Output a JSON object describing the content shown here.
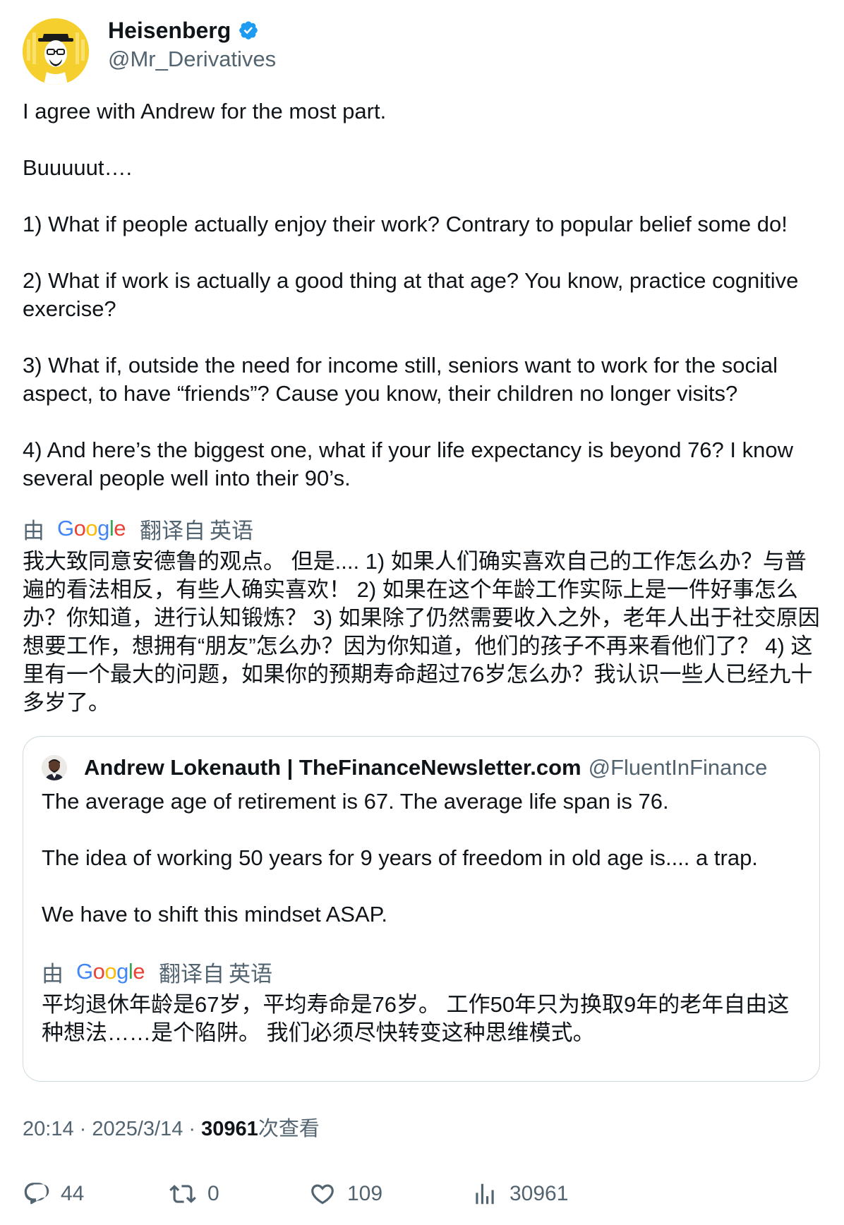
{
  "author": {
    "display_name": "Heisenberg",
    "handle": "@Mr_Derivatives",
    "verified": true,
    "avatar_icon": "heisenberg-avatar"
  },
  "tweet": {
    "text": "I agree with Andrew for the most part.\n\nBuuuuut….\n\n1) What if people actually enjoy their work? Contrary to popular belief some do!\n\n2) What if work is actually a good thing at that age? You know, practice cognitive exercise?\n\n3) What if, outside the need for income still, seniors want to work for the social aspect, to have “friends”? Cause you know, their children no longer visits?\n\n4) And here’s the biggest one, what if your life expectancy is beyond 76? I know several people well into their 90’s.",
    "translated_by_prefix": "由",
    "translated_by_suffix": "翻译自",
    "source_language": "英语",
    "translation": "我大致同意安德鲁的观点。 但是.... 1) 如果人们确实喜欢自己的工作怎么办？与普遍的看法相反，有些人确实喜欢！ 2) 如果在这个年龄工作实际上是一件好事怎么办？你知道，进行认知锻炼？ 3) 如果除了仍然需要收入之外，老年人出于社交原因想要工作，想拥有“朋友”怎么办？因为你知道，他们的孩子不再来看他们了？ 4) 这里有一个最大的问题，如果你的预期寿命超过76岁怎么办？我认识一些人已经九十多岁了。"
  },
  "quoted_tweet": {
    "display_name": "Andrew Lokenauth | TheFinanceNewsletter.com",
    "handle": "@FluentInFinance",
    "text": "The average age of retirement is 67. The average life span is 76.\n\nThe idea of working 50 years for 9 years of freedom in old age is.... a trap.\n\nWe have to shift this mindset ASAP.",
    "translated_by_prefix": "由",
    "translated_by_suffix": "翻译自",
    "source_language": "英语",
    "translation": "平均退休年龄是67岁，平均寿命是76岁。 工作50年只为换取9年的老年自由这种想法……是个陷阱。 我们必须尽快转变这种思维模式。"
  },
  "meta": {
    "time": "20:14",
    "separator": " · ",
    "date": "2025/3/14",
    "views_count": "30961",
    "views_label": "次查看"
  },
  "actions": {
    "replies": "44",
    "reposts": "0",
    "likes": "109",
    "views": "30961"
  },
  "colors": {
    "text_primary": "#0f1419",
    "text_secondary": "#536471",
    "verified_blue": "#1d9bf0",
    "border": "#cfd9de"
  }
}
